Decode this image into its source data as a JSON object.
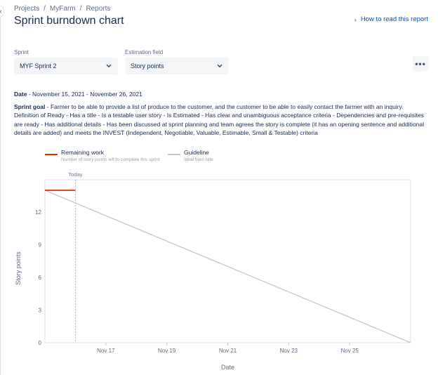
{
  "breadcrumb": {
    "projects": "Projects",
    "sep1": "/",
    "myfarm": "MyFarm",
    "sep2": "/",
    "reports": "Reports"
  },
  "page": {
    "title": "Sprint burndown chart",
    "help_link": "How to read this report"
  },
  "filters": {
    "sprint_label": "Sprint",
    "sprint_value": "MYF Sprint 2",
    "estimation_label": "Estimation field",
    "estimation_value": "Story points"
  },
  "date": {
    "label": "Date",
    "value": " - November 15, 2021 - November 26, 2021"
  },
  "goal": {
    "label": "Sprint goal",
    "text": " - Farmer to be able to provide a list of produce to the customer, and the customer to be able to easily contact the farmer with an inquiry. Definition of Ready - Has a title - Is a testable user story - Is Estimated - Has clear and unambiguous acceptance criteria - Dependencies and pre-requisites are ready - Has additional details - Has been discussed at sprint planning and team agrees the story is complete (it has an opening sentence and additional details are added) and meets the INVEST (Independent, Negotiable, Valuable, Estimable, Small & Testable) criteria"
  },
  "legend": {
    "remaining_title": "Remaining work",
    "remaining_sub": "Number of story points left to complete this sprint",
    "guideline_title": "Guideline",
    "guideline_sub": "Ideal burn rate"
  },
  "colors": {
    "remaining": "#de350b",
    "guideline": "#c1c7d0",
    "accent": "#0052cc"
  },
  "icons": {
    "help": "chevron-right-icon",
    "dropdown": "chevron-down-icon",
    "more": "more-icon",
    "collapse": "chevron-left-icon"
  },
  "chart_data": {
    "type": "line",
    "xlabel": "Date",
    "ylabel": "Story points",
    "ylim": [
      0,
      14
    ],
    "yticks": [
      0,
      3,
      6,
      9,
      12
    ],
    "xlim": [
      "Nov 15",
      "Nov 27"
    ],
    "xticks": [
      "Nov 17",
      "Nov 19",
      "Nov 21",
      "Nov 23",
      "Nov 25"
    ],
    "today_label": "Today",
    "today": "Nov 16",
    "series": [
      {
        "name": "Remaining work",
        "color": "#de350b",
        "points": [
          [
            "Nov 15",
            14
          ],
          [
            "Nov 16",
            14
          ]
        ]
      },
      {
        "name": "Guideline",
        "color": "#c1c7d0",
        "points": [
          [
            "Nov 15",
            14
          ],
          [
            "Nov 27",
            0
          ]
        ]
      }
    ]
  }
}
